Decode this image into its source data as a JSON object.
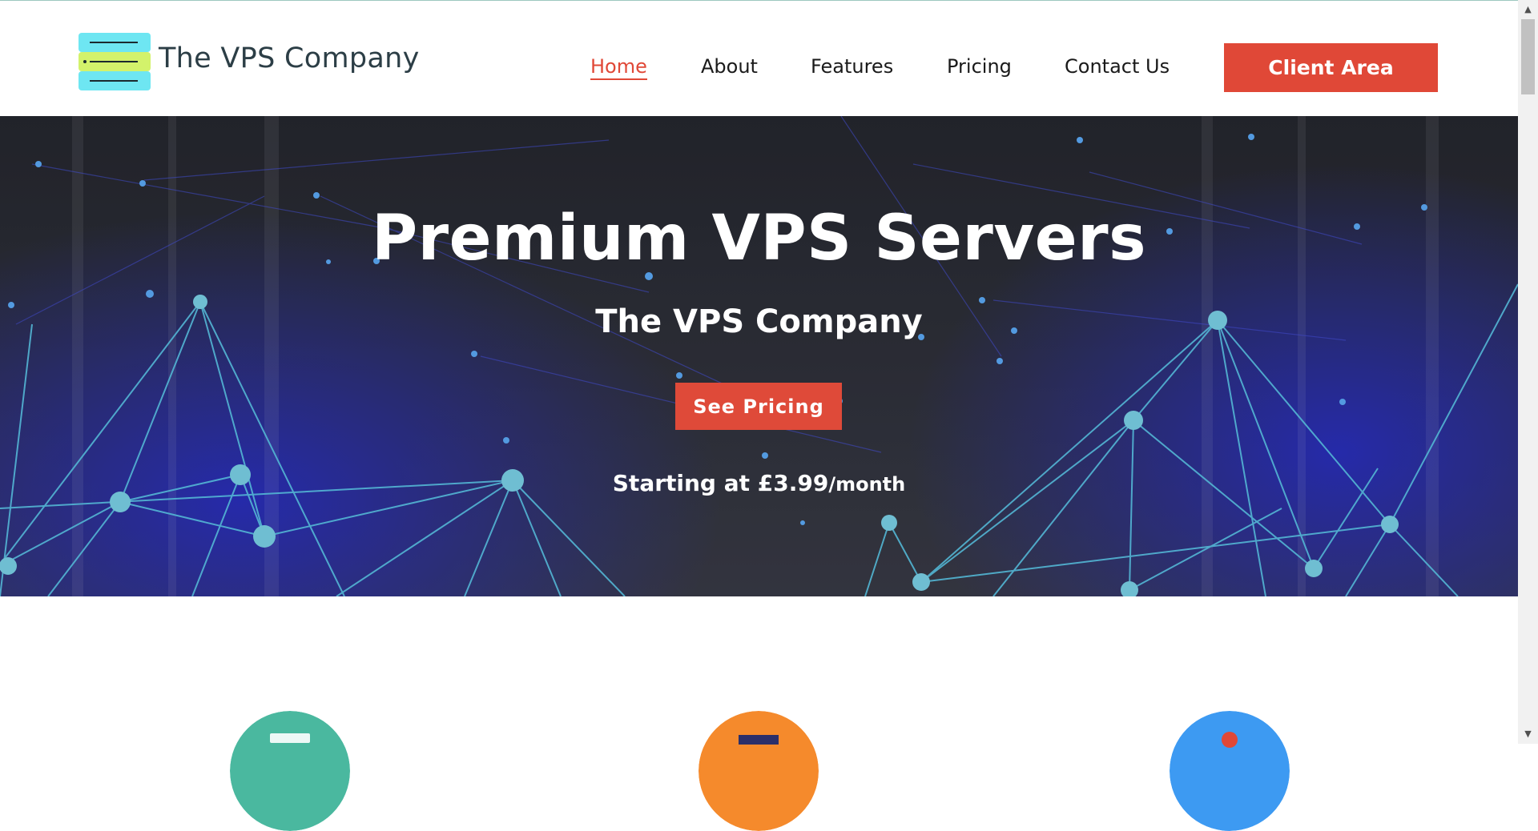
{
  "brand": {
    "name": "The VPS Company"
  },
  "nav": {
    "items": [
      {
        "label": "Home",
        "active": true
      },
      {
        "label": "About",
        "active": false
      },
      {
        "label": "Features",
        "active": false
      },
      {
        "label": "Pricing",
        "active": false
      },
      {
        "label": "Contact Us",
        "active": false
      }
    ],
    "cta_label": "Client Area"
  },
  "hero": {
    "title": "Premium VPS Servers",
    "subtitle": "The VPS Company",
    "button_label": "See Pricing",
    "price_prefix": "Starting at £3.99",
    "price_suffix": "/month"
  },
  "features": {
    "circles": [
      {
        "color": "#4ab89f",
        "icon": "server-icon"
      },
      {
        "color": "#f58a2c",
        "icon": "cpu-icon"
      },
      {
        "color": "#3d9af2",
        "icon": "globe-icon"
      }
    ]
  },
  "colors": {
    "accent": "#e04837",
    "brand_text": "#2c3e46",
    "logo_cyan": "#6ee6f2",
    "logo_lime": "#d3f26b",
    "hero_bg": "#1c1e2c",
    "network_line": "#4fc3f7"
  }
}
